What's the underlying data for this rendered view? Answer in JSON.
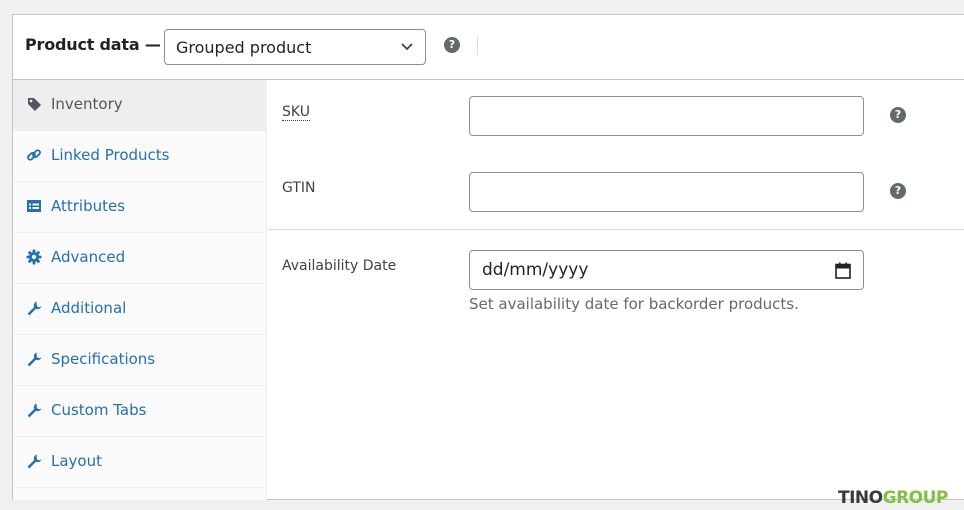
{
  "header": {
    "title": "Product data —",
    "product_type": "Grouped product",
    "help_glyph": "?"
  },
  "tabs": [
    {
      "label": "Inventory",
      "icon": "tag-icon",
      "active": true
    },
    {
      "label": "Linked Products",
      "icon": "link-icon"
    },
    {
      "label": "Attributes",
      "icon": "list-icon"
    },
    {
      "label": "Advanced",
      "icon": "gear-icon"
    },
    {
      "label": "Additional",
      "icon": "wrench-icon"
    },
    {
      "label": "Specifications",
      "icon": "wrench-icon"
    },
    {
      "label": "Custom Tabs",
      "icon": "wrench-icon"
    },
    {
      "label": "Layout",
      "icon": "wrench-icon"
    }
  ],
  "fields": {
    "sku_label": "SKU",
    "sku_value": "",
    "gtin_label": "GTIN",
    "gtin_value": "",
    "availability_label": "Availability Date",
    "availability_placeholder": "dd/mm/yyyy",
    "availability_description": "Set availability date for backorder products."
  },
  "brand": {
    "part1": "TINO",
    "part2": "GROUP"
  },
  "colors": {
    "link": "#2271b1",
    "active_tab_bg": "#eeeeee",
    "brand_green": "#7cc243"
  }
}
